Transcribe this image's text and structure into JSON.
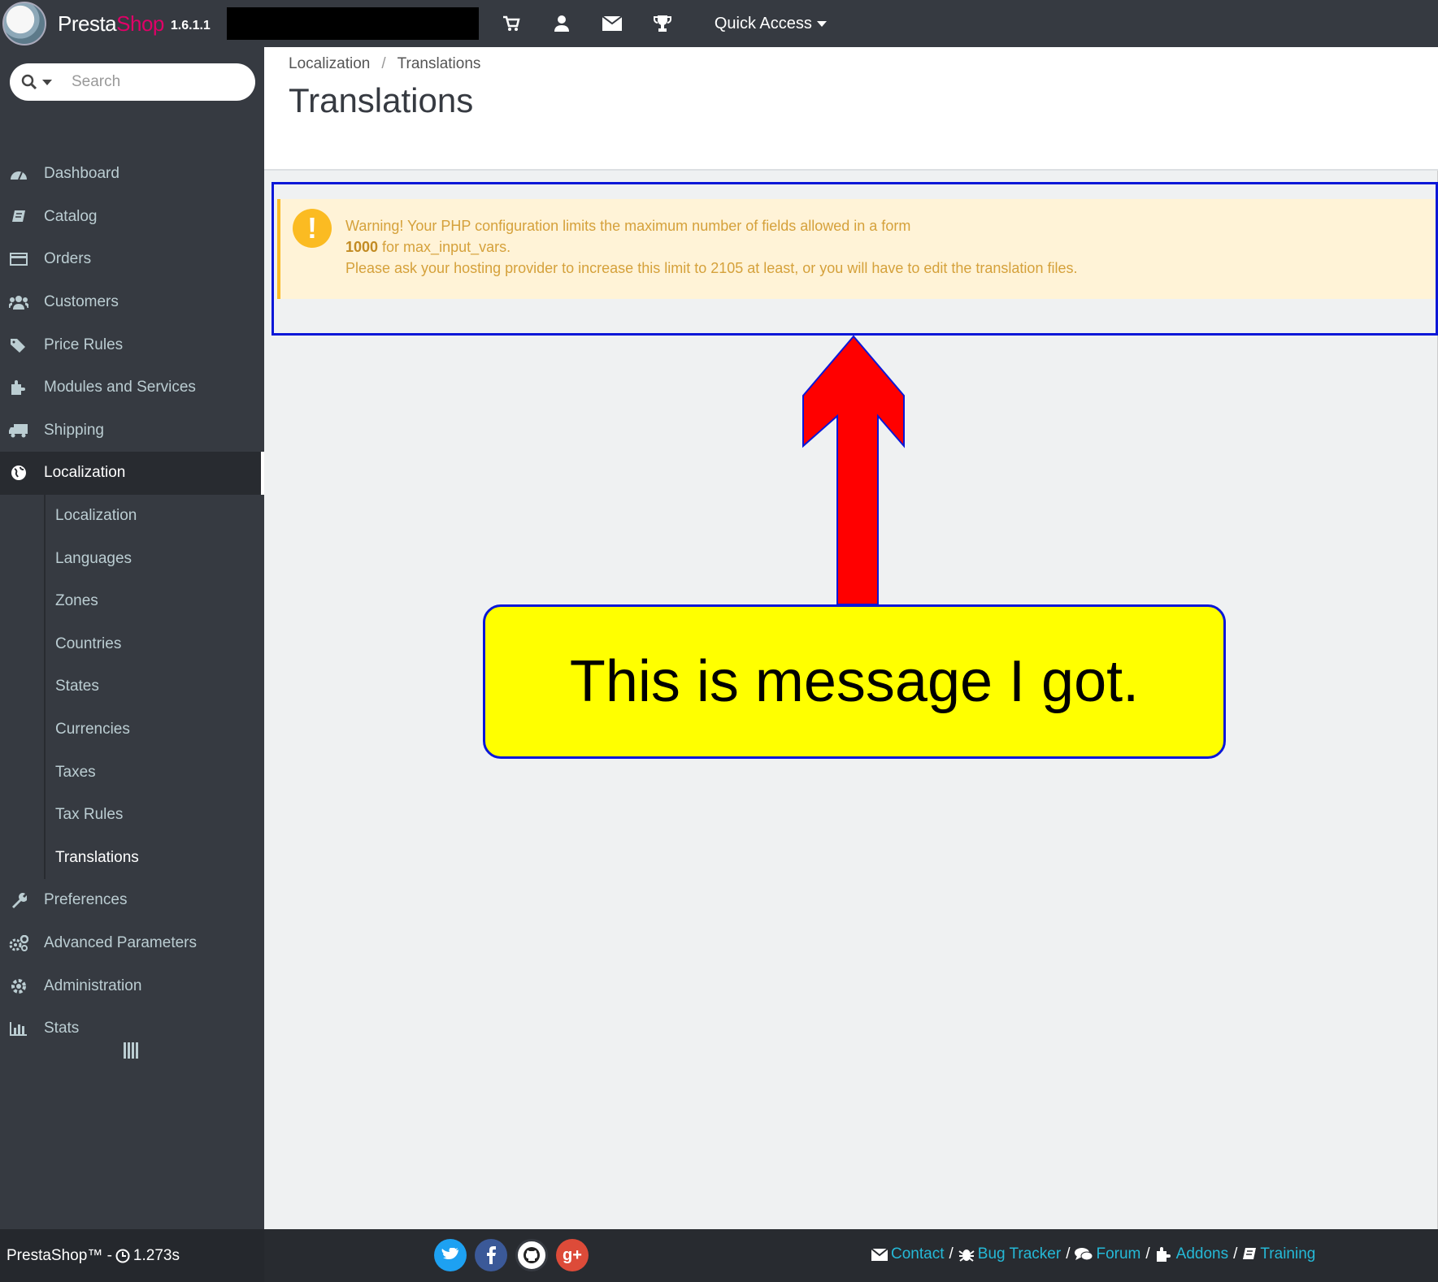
{
  "header": {
    "brand_presta": "Presta",
    "brand_shop": "Shop",
    "version": "1.6.1.1",
    "icons": [
      "cart-icon",
      "user-icon",
      "envelope-icon",
      "trophy-icon"
    ],
    "quick_access": "Quick Access"
  },
  "sidebar": {
    "search_placeholder": "Search",
    "items": [
      {
        "label": "Dashboard",
        "icon": "dashboard-icon"
      },
      {
        "label": "Catalog",
        "icon": "book-icon"
      },
      {
        "label": "Orders",
        "icon": "credit-card-icon"
      },
      {
        "label": "Customers",
        "icon": "users-icon"
      },
      {
        "label": "Price Rules",
        "icon": "tags-icon"
      },
      {
        "label": "Modules and Services",
        "icon": "puzzle-icon"
      },
      {
        "label": "Shipping",
        "icon": "truck-icon"
      },
      {
        "label": "Localization",
        "icon": "globe-icon"
      }
    ],
    "sub_items": [
      {
        "label": "Localization"
      },
      {
        "label": "Languages"
      },
      {
        "label": "Zones"
      },
      {
        "label": "Countries"
      },
      {
        "label": "States"
      },
      {
        "label": "Currencies"
      },
      {
        "label": "Taxes"
      },
      {
        "label": "Tax Rules"
      },
      {
        "label": "Translations"
      }
    ],
    "bottom_items": [
      {
        "label": "Preferences",
        "icon": "wrench-icon"
      },
      {
        "label": "Advanced Parameters",
        "icon": "cogs-icon"
      },
      {
        "label": "Administration",
        "icon": "gear-icon"
      },
      {
        "label": "Stats",
        "icon": "bar-chart-icon"
      }
    ]
  },
  "page": {
    "breadcrumb": [
      "Localization",
      "Translations"
    ],
    "breadcrumb_sep": "/",
    "title": "Translations"
  },
  "warning": {
    "line1": "Warning! Your PHP configuration limits the maximum number of fields allowed in a form",
    "line2_bold": "1000",
    "line2_rest": " for max_input_vars.",
    "line3": "Please ask your hosting provider to increase this limit to 2105 at least, or you will have to edit the translation files."
  },
  "annotation": {
    "callout_text": "This is message I got."
  },
  "footer": {
    "left_text": "PrestaShop™ - ",
    "time": "1.273s",
    "social": [
      "twitter-icon",
      "facebook-icon",
      "github-icon",
      "google-plus-icon"
    ],
    "links": [
      {
        "label": "Contact",
        "icon": "envelope-icon"
      },
      {
        "label": "Bug Tracker",
        "icon": "bug-icon"
      },
      {
        "label": "Forum",
        "icon": "comments-icon"
      },
      {
        "label": "Addons",
        "icon": "puzzle-icon"
      },
      {
        "label": "Training",
        "icon": "book-icon"
      }
    ],
    "link_sep": "/"
  },
  "colors": {
    "sidebar_bg": "#363a41",
    "warning_bg": "#fff3d7",
    "warning_text": "#d5a13b",
    "callout_bg": "#ffff00",
    "highlight_border": "#0a17d8",
    "arrow": "#ff0000",
    "link": "#25b9d7"
  }
}
